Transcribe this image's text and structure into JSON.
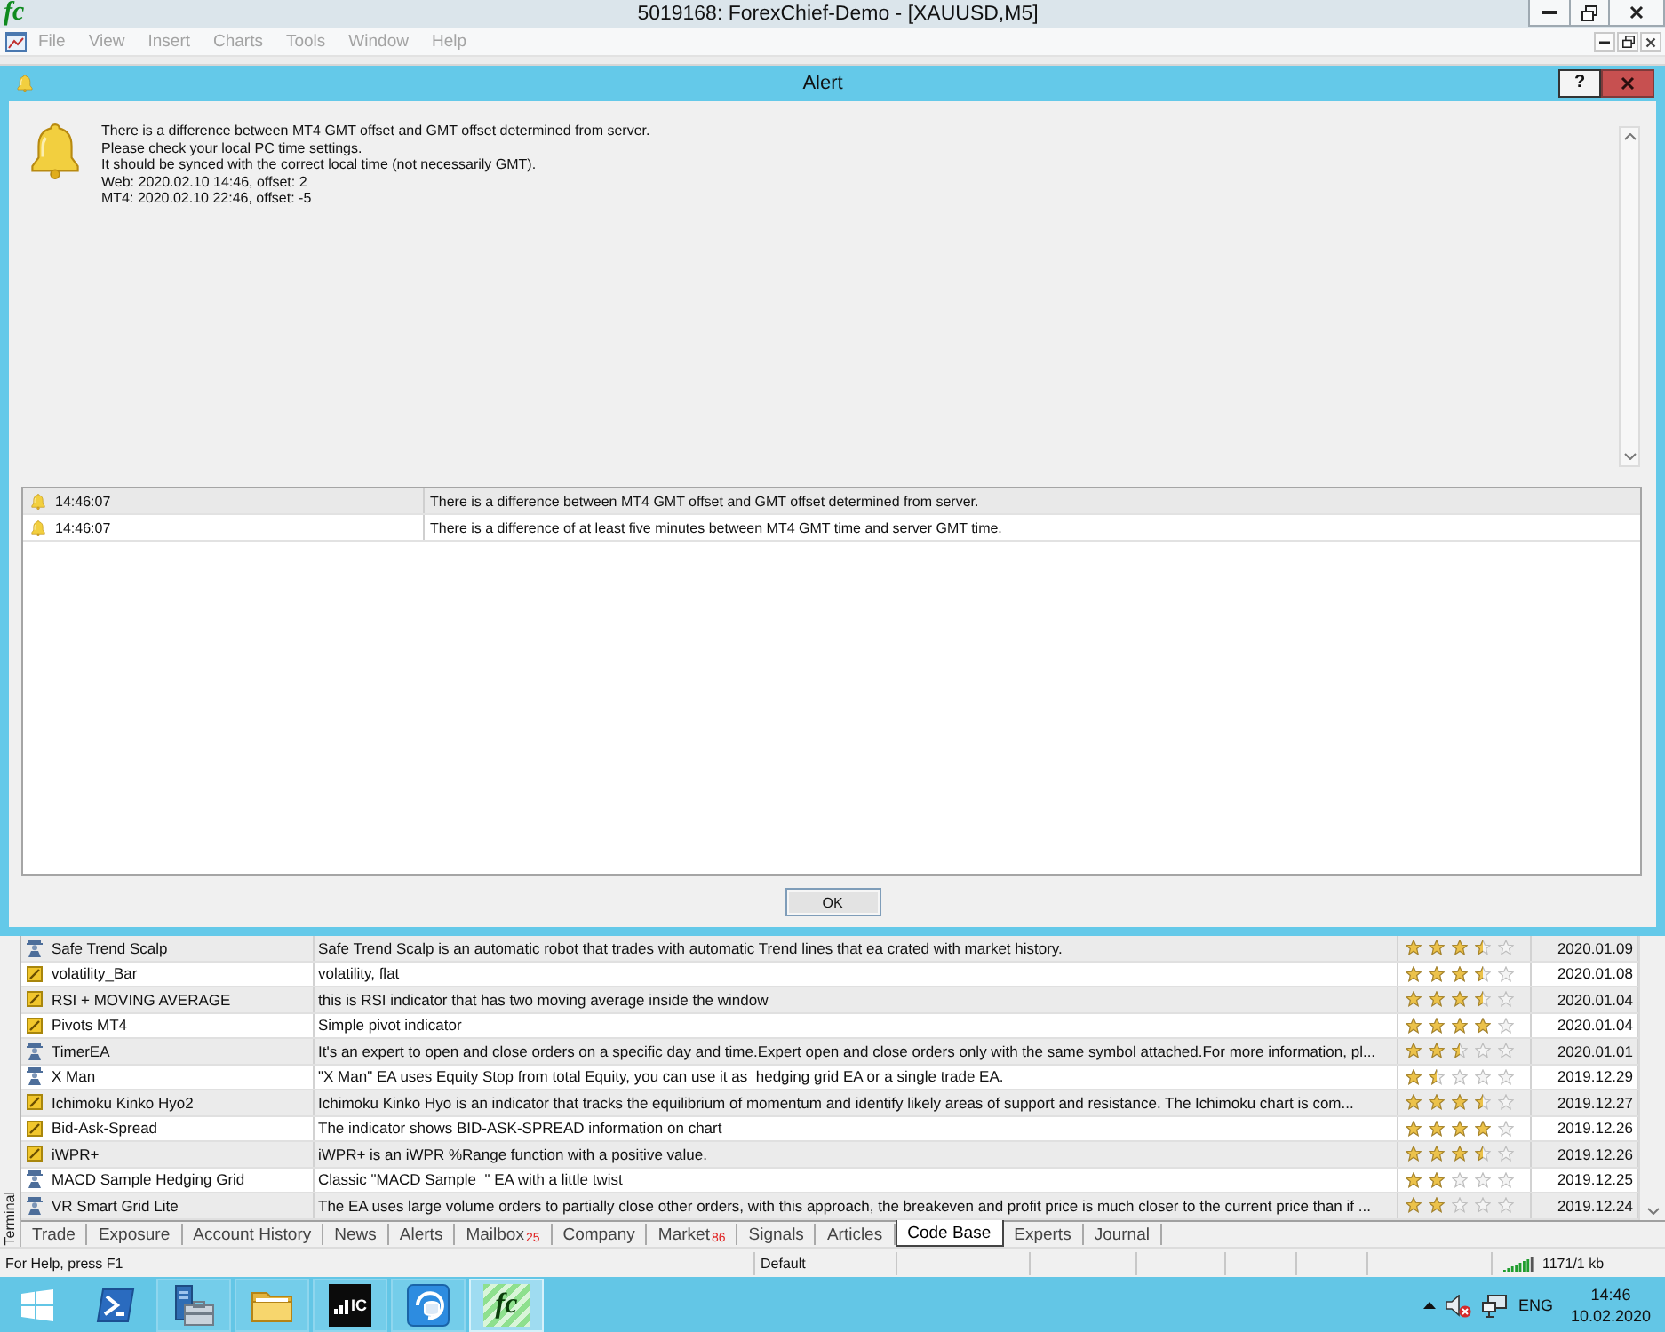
{
  "app": {
    "logo": "fc",
    "title": "5019168: ForexChief-Demo - [XAUUSD,M5]"
  },
  "menu": [
    {
      "label": "File",
      "disabled": true
    },
    {
      "label": "View",
      "disabled": true
    },
    {
      "label": "Insert",
      "disabled": true
    },
    {
      "label": "Charts",
      "disabled": true
    },
    {
      "label": "Tools",
      "disabled": true
    },
    {
      "label": "Window",
      "disabled": true
    },
    {
      "label": "Help",
      "disabled": true
    }
  ],
  "alert": {
    "title": "Alert",
    "help_button": "?",
    "message": [
      "There is a difference between MT4 GMT offset and GMT offset determined from server.",
      "Please check your local PC time settings.",
      "It should be synced with the correct local time (not necessarily GMT).",
      "Web: 2020.02.10 14:46, offset: 2",
      "MT4: 2020.02.10 22:46, offset: -5"
    ],
    "log": [
      {
        "time": "14:46:07",
        "message": "There is a difference between MT4 GMT offset and GMT offset determined from server.",
        "selected": true
      },
      {
        "time": "14:46:07",
        "message": "There is a difference of at least five minutes between MT4 GMT time and server GMT time.",
        "selected": false
      }
    ],
    "ok_button": "OK"
  },
  "terminal": {
    "label": "Terminal",
    "rows": [
      {
        "kind": "expert",
        "name": "Safe Trend Scalp",
        "description": "Safe Trend Scalp is an automatic robot that trades with automatic Trend lines that ea crated with market history.",
        "stars": 3.5,
        "date": "2020.01.09"
      },
      {
        "kind": "indicator",
        "name": "volatility_Bar",
        "description": "volatility, flat",
        "stars": 3.5,
        "date": "2020.01.08"
      },
      {
        "kind": "indicator",
        "name": "RSI + MOVING AVERAGE",
        "description": "this is RSI indicator that has two moving average inside the window",
        "stars": 3.5,
        "date": "2020.01.04"
      },
      {
        "kind": "indicator",
        "name": "Pivots MT4",
        "description": "Simple pivot indicator",
        "stars": 4,
        "date": "2020.01.04"
      },
      {
        "kind": "expert",
        "name": "TimerEA",
        "description": "It's an expert to open and close orders on a specific day and time.Expert open and close orders only with the same symbol attached.For more information, pl...",
        "stars": 2.5,
        "date": "2020.01.01"
      },
      {
        "kind": "expert",
        "name": "X Man",
        "description": "\"X Man\" EA uses Equity Stop from total Equity, you can use it as  hedging grid EA or a single trade EA.",
        "stars": 1.5,
        "date": "2019.12.29"
      },
      {
        "kind": "indicator",
        "name": "Ichimoku Kinko Hyo2",
        "description": "Ichimoku Kinko Hyo is an indicator that tracks the equilibrium of momentum and identify likely areas of support and resistance. The Ichimoku chart is com...",
        "stars": 3.5,
        "date": "2019.12.27"
      },
      {
        "kind": "indicator",
        "name": "Bid-Ask-Spread",
        "description": "The indicator shows BID-ASK-SPREAD information on chart",
        "stars": 4,
        "date": "2019.12.26"
      },
      {
        "kind": "indicator",
        "name": "iWPR+",
        "description": "iWPR+ is an iWPR %Range function with a positive value.",
        "stars": 3.5,
        "date": "2019.12.26"
      },
      {
        "kind": "expert",
        "name": "MACD Sample Hedging Grid",
        "description": "Classic \"MACD Sample  \" EA with a little twist",
        "stars": 2,
        "date": "2019.12.25"
      },
      {
        "kind": "expert",
        "name": "VR Smart Grid Lite",
        "description": "The EA uses large volume orders to partially close other orders, with this approach, the breakeven and profit price is much closer to the current price than if ...",
        "stars": 2,
        "date": "2019.12.24"
      }
    ],
    "tabs": [
      {
        "label": "Trade",
        "selected": false
      },
      {
        "label": "Exposure",
        "selected": false
      },
      {
        "label": "Account History",
        "selected": false
      },
      {
        "label": "News",
        "selected": false
      },
      {
        "label": "Alerts",
        "selected": false
      },
      {
        "label": "Mailbox",
        "count": "25",
        "selected": false
      },
      {
        "label": "Company",
        "selected": false
      },
      {
        "label": "Market",
        "count": "86",
        "selected": false
      },
      {
        "label": "Signals",
        "selected": false
      },
      {
        "label": "Articles",
        "selected": false
      },
      {
        "label": "Code Base",
        "selected": true
      },
      {
        "label": "Experts",
        "selected": false
      },
      {
        "label": "Journal",
        "selected": false
      }
    ]
  },
  "status_bar": {
    "help": "For Help, press F1",
    "profile": "Default",
    "traffic": "1171/1 kb"
  },
  "taskbar": {
    "apps": [
      {
        "kind": "powershell",
        "running": false,
        "selected": false
      },
      {
        "kind": "server-manager",
        "running": true,
        "selected": false
      },
      {
        "kind": "explorer",
        "running": true,
        "selected": false
      },
      {
        "kind": "chart-app",
        "logo": "IC",
        "running": true,
        "selected": false
      },
      {
        "kind": "database-app",
        "running": true,
        "selected": false
      },
      {
        "kind": "forex-app",
        "logo": "fc",
        "running": true,
        "selected": true
      }
    ],
    "language": "ENG",
    "time": "14:46",
    "date": "10.02.2020"
  }
}
